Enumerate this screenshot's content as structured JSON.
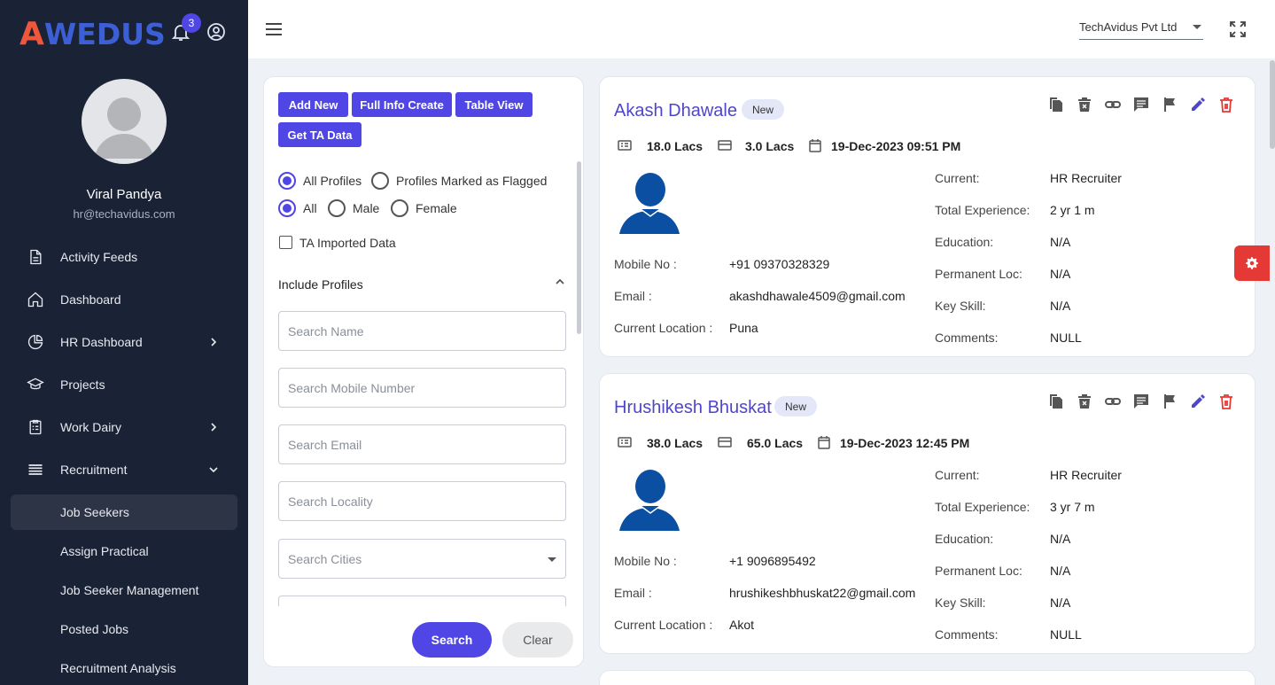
{
  "brand": {
    "logo_text": "WEDUS",
    "logo_a": "A"
  },
  "header": {
    "notification_count": "3",
    "company": "TechAvidus Pvt Ltd"
  },
  "user": {
    "name": "Viral Pandya",
    "email": "hr@techavidus.com"
  },
  "sidebar": {
    "items": [
      {
        "label": "Activity Feeds",
        "icon": "document-icon"
      },
      {
        "label": "Dashboard",
        "icon": "home-icon"
      },
      {
        "label": "HR Dashboard",
        "icon": "pie-chart-icon"
      },
      {
        "label": "Projects",
        "icon": "graduation-cap-icon"
      },
      {
        "label": "Work Dairy",
        "icon": "clipboard-icon"
      },
      {
        "label": "Recruitment",
        "icon": "list-icon"
      }
    ],
    "sub_items": [
      {
        "label": "Job Seekers",
        "active": true
      },
      {
        "label": "Assign Practical"
      },
      {
        "label": "Job Seeker Management"
      },
      {
        "label": "Posted Jobs"
      },
      {
        "label": "Recruitment Analysis"
      }
    ]
  },
  "filter": {
    "buttons": {
      "add_new": "Add New",
      "full_info": "Full Info Create",
      "table_view": "Table View",
      "get_ta": "Get TA Data"
    },
    "profile_options": {
      "all": "All Profiles",
      "flagged": "Profiles Marked as Flagged"
    },
    "gender_options": {
      "all": "All",
      "male": "Male",
      "female": "Female"
    },
    "ta_imported": "TA Imported Data",
    "include_profiles": "Include Profiles",
    "placeholders": {
      "name": "Search Name",
      "mobile": "Search Mobile Number",
      "email": "Search Email",
      "locality": "Search Locality",
      "cities": "Search Cities"
    },
    "search": "Search",
    "clear": "Clear"
  },
  "labels": {
    "mobile": "Mobile No :",
    "email": "Email :",
    "location": "Current Location :",
    "current": "Current:",
    "experience": "Total Experience:",
    "education": "Education:",
    "permanent": "Permanent Loc:",
    "skill": "Key Skill:",
    "comments": "Comments:"
  },
  "profiles": [
    {
      "name": "Akash Dhawale",
      "badge": "New",
      "ctc": "18.0 Lacs",
      "ectc": "3.0 Lacs",
      "date": "19-Dec-2023 09:51 PM",
      "mobile": "+91 09370328329",
      "email": "akashdhawale4509@gmail.com",
      "location": "Puna",
      "current": "HR Recruiter",
      "experience": "2 yr 1 m",
      "education": "N/A",
      "permanent": "N/A",
      "skill": "N/A",
      "comments": "NULL"
    },
    {
      "name": "Hrushikesh Bhuskat",
      "badge": "New",
      "ctc": "38.0 Lacs",
      "ectc": "65.0 Lacs",
      "date": "19-Dec-2023 12:45 PM",
      "mobile": "+1 9096895492",
      "email": "hrushikeshbhuskat22@gmail.com",
      "location": "Akot",
      "current": "HR Recruiter",
      "experience": "3 yr 7 m",
      "education": "N/A",
      "permanent": "N/A",
      "skill": "N/A",
      "comments": "NULL"
    }
  ],
  "colors": {
    "accent": "#4f46e5",
    "sidebar": "#1a2235",
    "danger": "#e53935",
    "brand_blue": "#3d5fd6",
    "brand_orange": "#f0573a"
  }
}
